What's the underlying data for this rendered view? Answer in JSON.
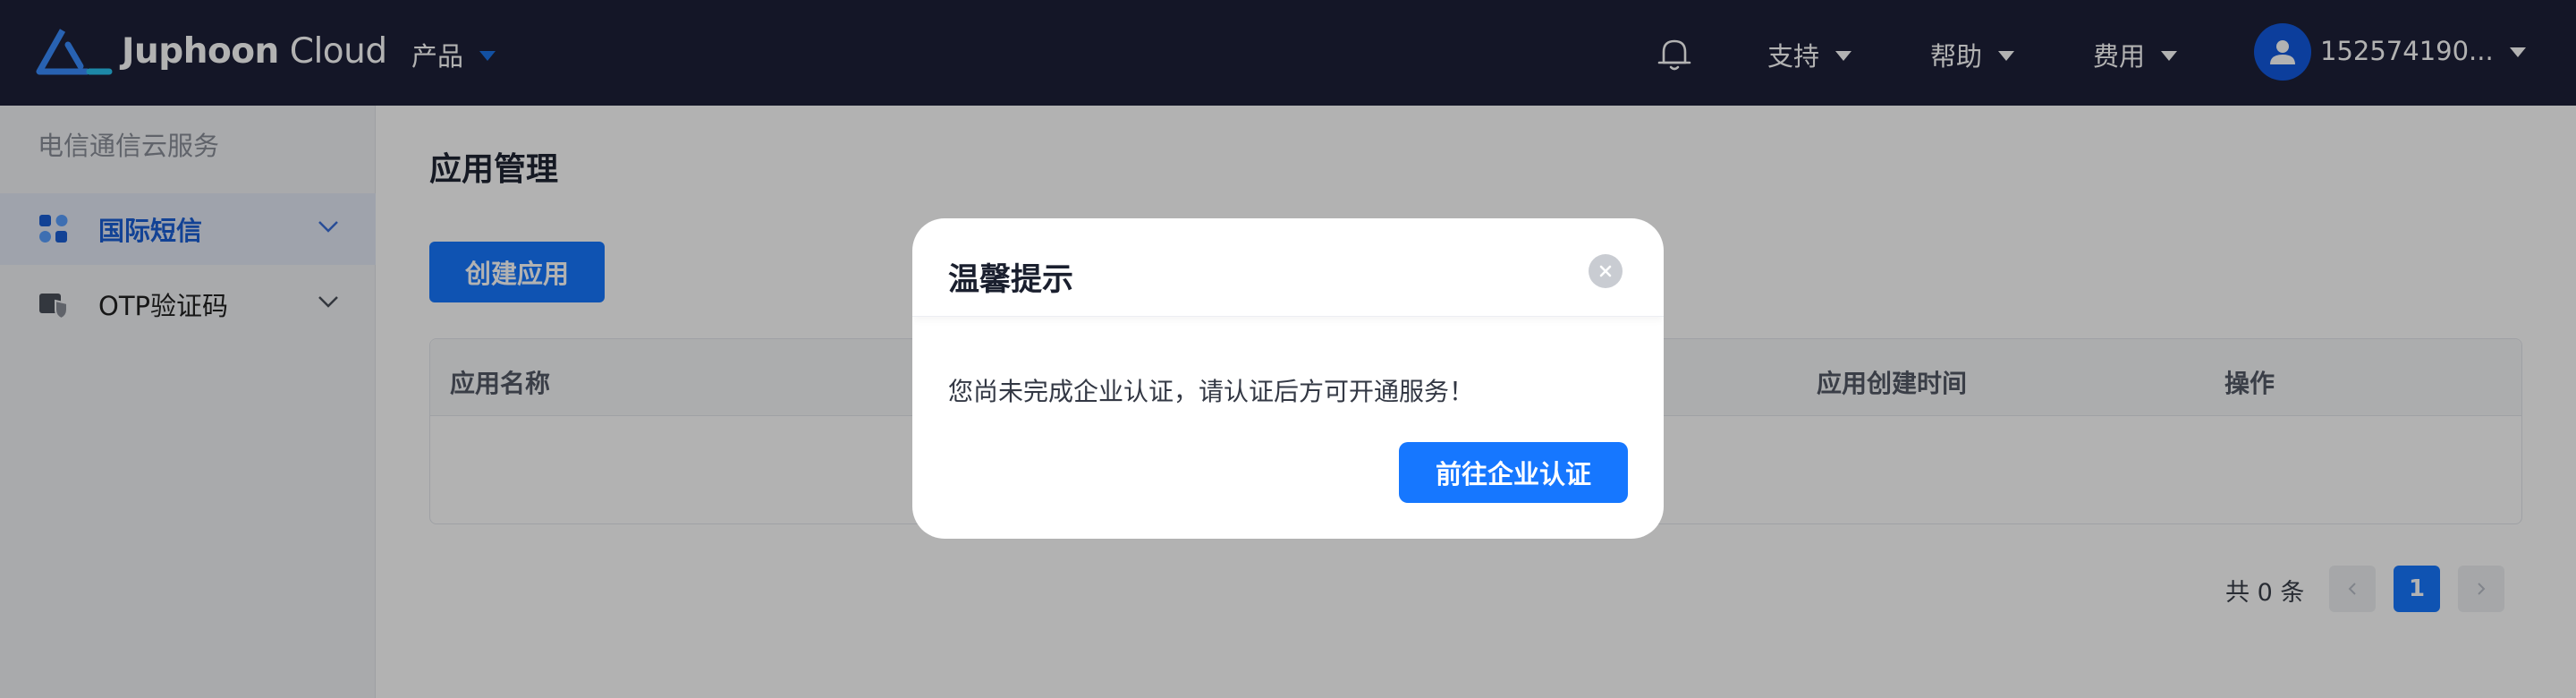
{
  "header": {
    "brand_bold": "Juphoon",
    "brand_light": " Cloud",
    "products_label": "产品",
    "support_label": "支持",
    "help_label": "帮助",
    "billing_label": "费用",
    "username": "152574190..."
  },
  "sidebar": {
    "section_title": "电信通信云服务",
    "items": [
      {
        "label": "国际短信",
        "active": true,
        "icon": "apps-grid-icon"
      },
      {
        "label": "OTP验证码",
        "active": false,
        "icon": "shield-card-icon"
      }
    ]
  },
  "main": {
    "page_title": "应用管理",
    "create_button": "创建应用",
    "table_columns": [
      "应用名称",
      "应用创建时间",
      "操作"
    ],
    "pagination": {
      "total_label": "共 0 条",
      "current_page": "1"
    }
  },
  "modal": {
    "title": "温馨提示",
    "message": "您尚未完成企业认证，请认证后方可开通服务！",
    "action_button": "前往企业认证"
  },
  "colors": {
    "topbar": "#1d2038",
    "primary": "#1677ff",
    "sidebar_active_bg": "#e4eaf6",
    "sidebar_active_text": "#1a5fd6"
  }
}
